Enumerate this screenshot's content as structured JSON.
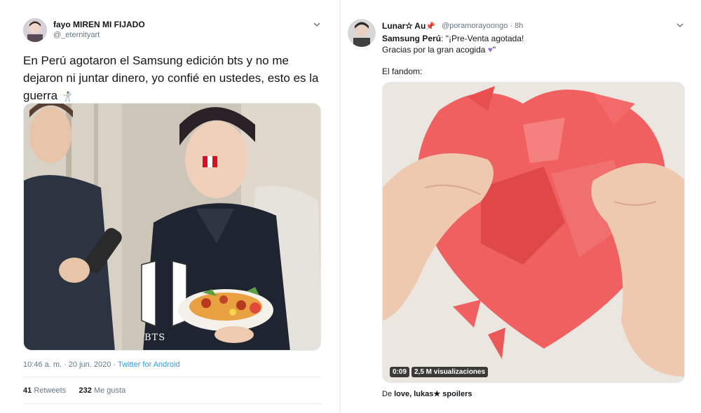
{
  "left_tweet": {
    "display_name": "fayo MIREN MI FIJADO",
    "handle": "@_eternityart",
    "text_line1": "En Perú agotaron el Samsung edición bts y no me",
    "text_line2": "dejaron ni juntar dinero, yo confié en ustedes, esto es la",
    "text_line3": "guerra",
    "image_caption": "BTS",
    "timestamp": "10:46 a. m. · 20 jun. 2020 · ",
    "source": "Twitter for Android",
    "retweets_count": "41",
    "retweets_label": "Retweets",
    "likes_count": "232",
    "likes_label": "Me gusta"
  },
  "right_tweet": {
    "display_name": "Lunar✫ Au",
    "handle": "@poramorayoongo · 8h",
    "quote_name": "Samsung Perú",
    "quote_text1": ": \"¡Pre-Venta agotada!",
    "quote_text2": "Gracias por la gran acogida",
    "quote_end": "\"",
    "text_fandom": "El fandom:",
    "video_time": "0:09",
    "video_views": "2,5 M visualizaciones",
    "from_label": "De",
    "from_source": "love, lukas★ spoilers"
  },
  "colors": {
    "link": "#1da1f2",
    "muted": "#657786",
    "heart_red": "#f06060",
    "flag_red": "#d91023"
  }
}
